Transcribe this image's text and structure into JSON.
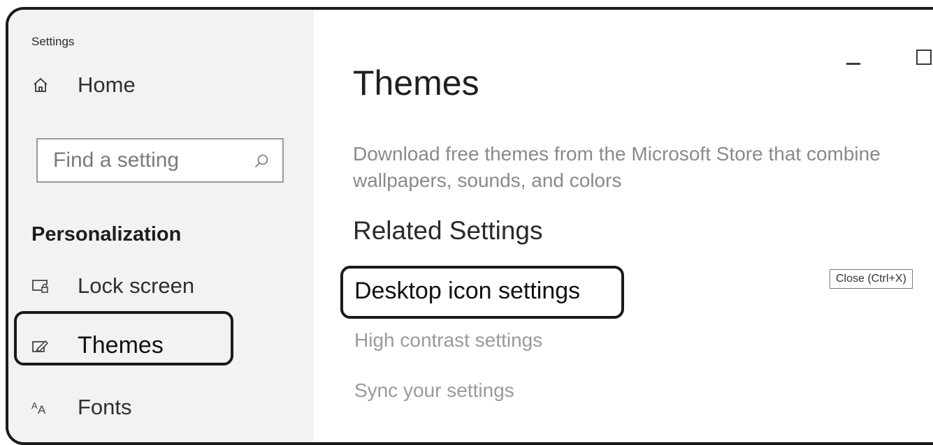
{
  "app": {
    "title": "Settings"
  },
  "sidebar": {
    "home_label": "Home",
    "search": {
      "placeholder": "Find a setting",
      "value": ""
    },
    "section_heading": "Personalization",
    "items": [
      {
        "label": "Lock screen",
        "icon": "lock-screen-icon",
        "selected": false
      },
      {
        "label": "Themes",
        "icon": "themes-icon",
        "selected": true
      },
      {
        "label": "Fonts",
        "icon": "fonts-icon",
        "selected": false
      }
    ]
  },
  "main": {
    "title": "Themes",
    "description": "Download free themes from the Microsoft Store that combine wallpapers, sounds, and colors",
    "related_heading": "Related Settings",
    "links": [
      {
        "label": "Desktop icon settings"
      },
      {
        "label": "High contrast settings"
      },
      {
        "label": "Sync your settings"
      }
    ]
  },
  "tooltip": {
    "text": "Close (Ctrl+X)"
  },
  "colors": {
    "sidebar_bg": "#f2f2f2",
    "highlight_border": "#1a1a1a",
    "muted_text": "#8a8a8a"
  }
}
